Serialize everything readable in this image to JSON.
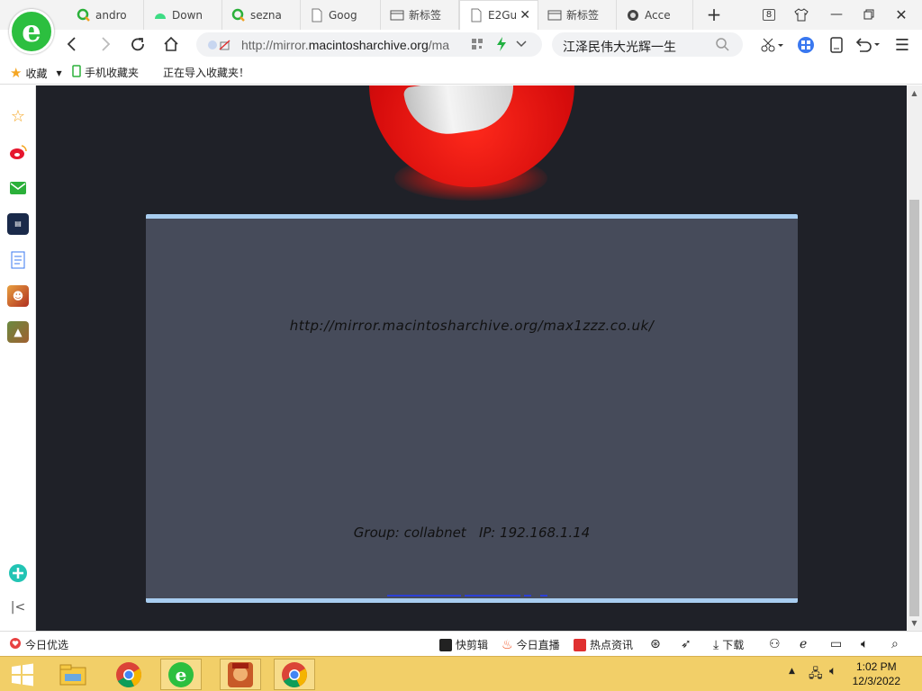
{
  "browser": {
    "tabs": [
      {
        "label": "andro",
        "icon": "green-search-icon"
      },
      {
        "label": "Down",
        "icon": "android-icon"
      },
      {
        "label": "sezna",
        "icon": "green-search-icon"
      },
      {
        "label": "Goog",
        "icon": "page-icon"
      },
      {
        "label": "新标签",
        "icon": "newtab-icon"
      },
      {
        "label": "E2Gu",
        "icon": "page-icon",
        "active": true
      },
      {
        "label": "新标签",
        "icon": "newtab-icon"
      },
      {
        "label": "Acce",
        "icon": "access-icon"
      }
    ],
    "tab_count": "8",
    "url_prefix": "http://mirror.",
    "url_domain": "macintosharchive.org",
    "url_suffix": "/ma",
    "search_text": "江泽民伟大光辉一生"
  },
  "bookmarks": {
    "favorites": "收藏",
    "mobile_favorites": "手机收藏夹",
    "importing": "正在导入收藏夹！"
  },
  "page": {
    "url_text": "http://mirror.macintosharchive.org/max1zzz.co.uk/",
    "info_text": "Group: collabnet   IP: 192.168.1.14"
  },
  "statusbar": {
    "left": "今日优选",
    "items": [
      "快剪辑",
      "今日直播",
      "热点资讯",
      "下载"
    ]
  },
  "taskbar": {
    "time": "1:02 PM",
    "date": "12/3/2022"
  },
  "colors": {
    "content_bg": "#1f2128",
    "panel_bg": "#464b5a",
    "panel_border": "#a8cdf0",
    "taskbar": "#f2cf68",
    "brand_green": "#2cbf3f"
  }
}
